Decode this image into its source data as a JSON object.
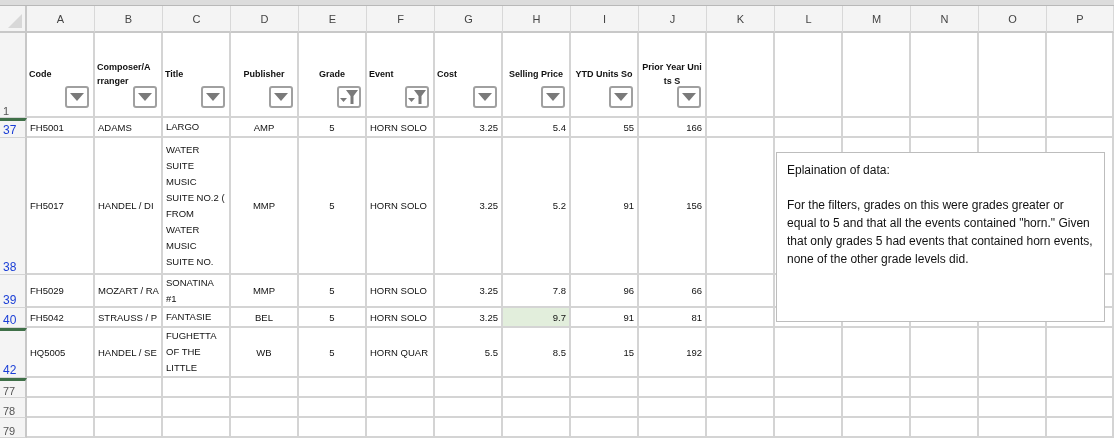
{
  "column_letters": [
    "A",
    "B",
    "C",
    "D",
    "E",
    "F",
    "G",
    "H",
    "I",
    "J",
    "K",
    "L",
    "M",
    "N",
    "O",
    "P"
  ],
  "header_row": {
    "number": "1",
    "cells": [
      {
        "label": "Code",
        "filtered": false
      },
      {
        "label": "Composer/Arranger",
        "filtered": false
      },
      {
        "label": "Title",
        "filtered": false
      },
      {
        "label": "Publisher",
        "filtered": false
      },
      {
        "label": "Grade",
        "filtered": true
      },
      {
        "label": "Event",
        "filtered": true
      },
      {
        "label": "Cost",
        "filtered": false
      },
      {
        "label": "Selling Price",
        "filtered": false
      },
      {
        "label": "YTD Units So",
        "filtered": false
      },
      {
        "label": "Prior Year Units S",
        "filtered": false
      }
    ]
  },
  "rows": [
    {
      "number": "37",
      "filtered": true,
      "hidden_above": true,
      "cells": [
        {
          "text": "FH5001",
          "selected": false
        },
        {
          "text": "ADAMS",
          "selected": false
        },
        {
          "text": "LARGO",
          "selected": false
        },
        {
          "text": "AMP",
          "selected": false
        },
        {
          "text": "5",
          "selected": false
        },
        {
          "text": "HORN SOLO",
          "selected": false
        },
        {
          "text": "3.25",
          "selected": false
        },
        {
          "text": "5.4",
          "selected": false
        },
        {
          "text": "55",
          "selected": false
        },
        {
          "text": "166",
          "selected": false
        }
      ]
    },
    {
      "number": "38",
      "filtered": true,
      "hidden_above": false,
      "cells": [
        {
          "text": "FH5017",
          "selected": false
        },
        {
          "text": "HANDEL / DI",
          "selected": false
        },
        {
          "text": "WATER SUITE MUSIC SUITE NO.2 ( FROM WATER MUSIC SUITE NO.",
          "selected": false
        },
        {
          "text": "MMP",
          "selected": false
        },
        {
          "text": "5",
          "selected": false
        },
        {
          "text": "HORN SOLO",
          "selected": false
        },
        {
          "text": "3.25",
          "selected": false
        },
        {
          "text": "5.2",
          "selected": false
        },
        {
          "text": "91",
          "selected": false
        },
        {
          "text": "156",
          "selected": false
        }
      ]
    },
    {
      "number": "39",
      "filtered": true,
      "hidden_above": false,
      "cells": [
        {
          "text": "FH5029",
          "selected": false
        },
        {
          "text": "MOZART / RA",
          "selected": false
        },
        {
          "text": "SONATINA #1",
          "selected": false
        },
        {
          "text": "MMP",
          "selected": false
        },
        {
          "text": "5",
          "selected": false
        },
        {
          "text": "HORN SOLO",
          "selected": false
        },
        {
          "text": "3.25",
          "selected": false
        },
        {
          "text": "7.8",
          "selected": false
        },
        {
          "text": "96",
          "selected": false
        },
        {
          "text": "66",
          "selected": false
        }
      ]
    },
    {
      "number": "40",
      "filtered": true,
      "hidden_above": false,
      "cells": [
        {
          "text": "FH5042",
          "selected": false
        },
        {
          "text": "STRAUSS / P",
          "selected": false
        },
        {
          "text": "FANTASIE",
          "selected": false
        },
        {
          "text": "BEL",
          "selected": false
        },
        {
          "text": "5",
          "selected": false
        },
        {
          "text": "HORN SOLO",
          "selected": false
        },
        {
          "text": "3.25",
          "selected": false
        },
        {
          "text": "9.7",
          "selected": true
        },
        {
          "text": "91",
          "selected": false
        },
        {
          "text": "81",
          "selected": false
        }
      ]
    },
    {
      "number": "42",
      "filtered": true,
      "hidden_above": true,
      "cells": [
        {
          "text": "HQ5005",
          "selected": false
        },
        {
          "text": "HANDEL / SE",
          "selected": false
        },
        {
          "text": "FUGHETTA OF THE LITTLE",
          "selected": false
        },
        {
          "text": "WB",
          "selected": false
        },
        {
          "text": "5",
          "selected": false
        },
        {
          "text": "HORN QUAR",
          "selected": false
        },
        {
          "text": "5.5",
          "selected": false
        },
        {
          "text": "8.5",
          "selected": false
        },
        {
          "text": "15",
          "selected": false
        },
        {
          "text": "192",
          "selected": false
        }
      ]
    },
    {
      "number": "77",
      "filtered": false,
      "hidden_above": true,
      "cells": []
    },
    {
      "number": "78",
      "filtered": false,
      "hidden_above": false,
      "cells": []
    },
    {
      "number": "79",
      "filtered": false,
      "hidden_above": false,
      "cells": []
    }
  ],
  "text_box": {
    "title": "Eplaination of data:",
    "body": "For the filters, grades on this were grades greater or equal to 5 and that all the events contained \"horn.\" Given that only grades 5 had events that contained horn events, none of the other grade levels did."
  }
}
